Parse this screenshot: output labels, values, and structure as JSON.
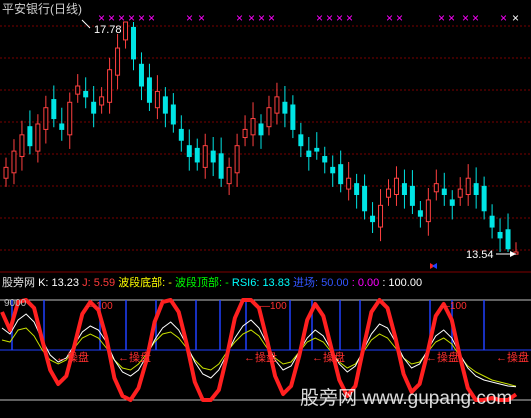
{
  "window": {
    "title": "平安银行(日线)"
  },
  "main_panel": {
    "annotations": {
      "high": "17.78",
      "low": "13.54"
    }
  },
  "indicator_panel": {
    "name": "股旁网",
    "values": [
      {
        "label": "K:",
        "value": "13.23",
        "color": "#ffffff"
      },
      {
        "label": "J:",
        "value": "5.59",
        "color": "#ff3b3b"
      },
      {
        "label": "波段底部:",
        "value": "-",
        "color": "#ffff00"
      },
      {
        "label": "波段顶部:",
        "value": "-",
        "color": "#00ff00"
      },
      {
        "label": "RSI6:",
        "value": "13.83",
        "color": "#00ffff"
      },
      {
        "label": "进场:",
        "value": "50.00",
        "color": "#3355ff"
      },
      {
        "label": "",
        "value": "0.00",
        "color": "#ff00ff"
      },
      {
        "label": "",
        "value": "100.00",
        "color": "#ffffff"
      }
    ],
    "reference_labels": {
      "upper": "100",
      "signal": "操盘",
      "upper_left": "9000"
    }
  },
  "watermark": "股旁网 www.gupang.com",
  "colors": {
    "background": "#000000",
    "up_candle": "#ff4040",
    "down_candle": "#00e5e5",
    "k_line": "#ffffff",
    "j_line": "#ff2020",
    "rsi_line": "#ffff00",
    "entry_line": "#2040ff",
    "marker": "#ff00ff"
  },
  "chart_data": [
    {
      "type": "candlestick",
      "title": "平安银行(日线)",
      "closes": [
        15.1,
        15.4,
        15.7,
        15.5,
        15.9,
        16.2,
        16.0,
        15.8,
        16.3,
        16.6,
        16.4,
        16.1,
        16.4,
        16.9,
        17.3,
        17.78,
        17.1,
        16.6,
        16.3,
        16.5,
        16.1,
        15.9,
        15.6,
        15.3,
        15.2,
        15.5,
        15.2,
        14.9,
        15.1,
        15.5,
        15.8,
        16.0,
        15.7,
        16.2,
        16.4,
        16.1,
        15.8,
        15.5,
        15.3,
        15.4,
        15.2,
        15.0,
        14.8,
        14.9,
        14.6,
        14.3,
        14.1,
        14.4,
        14.7,
        14.9,
        14.6,
        14.4,
        14.2,
        14.5,
        14.8,
        14.6,
        14.4,
        14.7,
        14.9,
        14.6,
        14.3,
        14.0,
        13.8,
        13.6,
        13.54
      ],
      "high": 17.78,
      "low": 13.54,
      "marker_text": "× × ×"
    },
    {
      "type": "line",
      "title": "股旁网",
      "ylim": [
        0,
        100
      ],
      "series": [
        {
          "name": "K",
          "values": [
            72,
            66,
            80,
            86,
            78,
            60,
            45,
            38,
            42,
            55,
            68,
            74,
            70,
            58,
            40,
            28,
            24,
            30,
            44,
            60,
            72,
            78,
            70,
            55,
            38,
            26,
            22,
            30,
            46,
            62,
            74,
            80,
            72,
            56,
            40,
            30,
            34,
            48,
            62,
            70,
            64,
            50,
            36,
            28,
            34,
            50,
            66,
            76,
            72,
            58,
            42,
            32,
            36,
            50,
            64,
            70,
            62,
            46,
            32,
            24,
            20,
            18,
            16,
            14,
            13.23
          ]
        },
        {
          "name": "J",
          "values": [
            88,
            70,
            98,
            100,
            92,
            60,
            30,
            16,
            24,
            54,
            86,
            98,
            90,
            62,
            22,
            4,
            0,
            12,
            40,
            78,
            98,
            100,
            88,
            56,
            18,
            0,
            0,
            10,
            44,
            82,
            100,
            100,
            92,
            60,
            24,
            6,
            14,
            44,
            80,
            96,
            84,
            52,
            20,
            4,
            14,
            52,
            88,
            100,
            92,
            62,
            26,
            8,
            16,
            48,
            84,
            96,
            80,
            44,
            12,
            0,
            0,
            2,
            0,
            0,
            5.59
          ]
        },
        {
          "name": "RSI6",
          "values": [
            60,
            58,
            70,
            72,
            64,
            50,
            40,
            36,
            40,
            52,
            62,
            66,
            62,
            52,
            40,
            32,
            30,
            36,
            46,
            58,
            66,
            68,
            62,
            52,
            40,
            32,
            30,
            36,
            48,
            58,
            66,
            70,
            64,
            52,
            42,
            36,
            38,
            48,
            58,
            62,
            58,
            48,
            38,
            32,
            36,
            48,
            60,
            66,
            62,
            52,
            42,
            36,
            38,
            48,
            58,
            62,
            56,
            44,
            34,
            28,
            24,
            20,
            18,
            16,
            13.83
          ]
        },
        {
          "name": "进场",
          "values": [
            50,
            50,
            50,
            50,
            50,
            50,
            50,
            50,
            50,
            50,
            50,
            50,
            50,
            50,
            50,
            50,
            50,
            50,
            50,
            50,
            50,
            50,
            50,
            50,
            50,
            50,
            50,
            50,
            50,
            50,
            50,
            50,
            50,
            50,
            50,
            50,
            50,
            50,
            50,
            50,
            50,
            50,
            50,
            50,
            50,
            50,
            50,
            50,
            50,
            50,
            50,
            50,
            50,
            50,
            50,
            50,
            50,
            50,
            50,
            50,
            50,
            50,
            50,
            50,
            50
          ]
        }
      ]
    }
  ]
}
